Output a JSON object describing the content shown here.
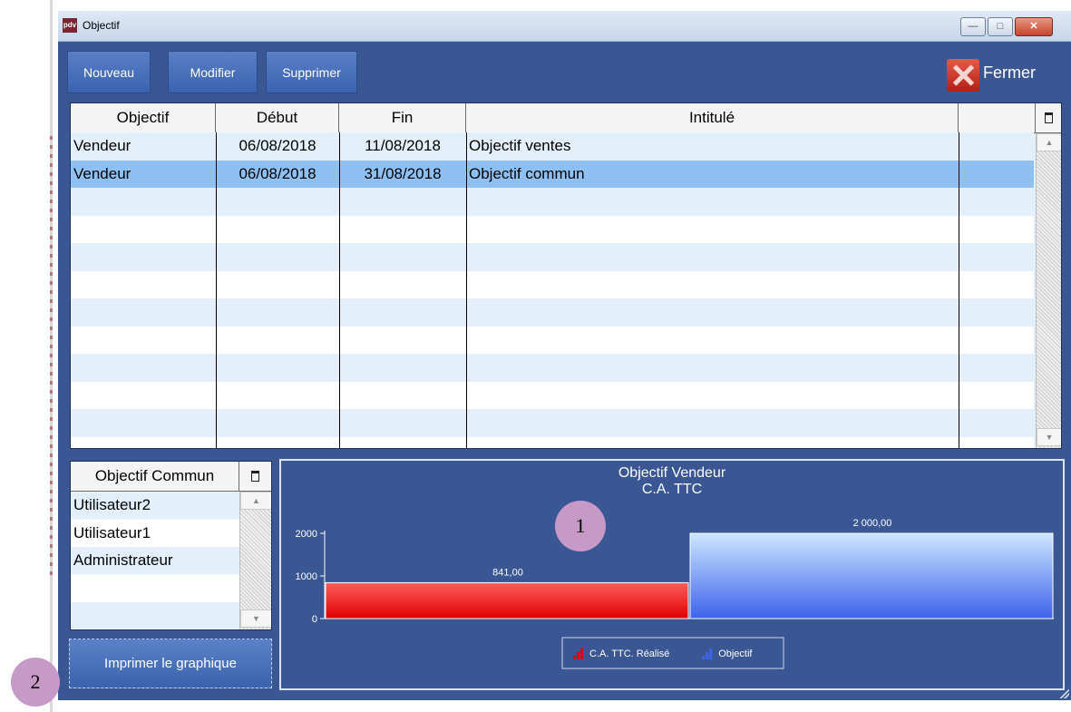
{
  "window": {
    "title": "Objectif",
    "app_icon_text": "pdv",
    "controls": {
      "minimize": "—",
      "maximize": "□",
      "close": "✕"
    }
  },
  "toolbar": {
    "new_label": "Nouveau",
    "modify_label": "Modifier",
    "delete_label": "Supprimer",
    "close_label": "Fermer"
  },
  "objectives_table": {
    "columns": [
      "Objectif",
      "Début",
      "Fin",
      "Intitulé"
    ],
    "rows": [
      {
        "objectif": "Vendeur",
        "debut": "06/08/2018",
        "fin": "11/08/2018",
        "intitule": "Objectif ventes"
      },
      {
        "objectif": "Vendeur",
        "debut": "06/08/2018",
        "fin": "31/08/2018",
        "intitule": "Objectif commun"
      }
    ],
    "selected_row": 1,
    "colors": {
      "row_light": "#e3f0fb",
      "row_white": "#ffffff",
      "row_selected": "#8fc0f2"
    }
  },
  "common_table": {
    "column": "Objectif Commun",
    "rows": [
      "Utilisateur2",
      "Utilisateur1",
      "Administrateur"
    ]
  },
  "print_button": {
    "label": "Imprimer le graphique"
  },
  "callouts": {
    "chart": "1",
    "print": "2"
  },
  "chart_data": {
    "type": "bar",
    "title": "Objectif Vendeur",
    "subtitle": "C.A. TTC",
    "ylim": [
      0,
      2000
    ],
    "yticks": [
      0,
      1000,
      2000
    ],
    "series": [
      {
        "name": "C.A. TTC. Réalisé",
        "value": 841.0,
        "label": "841,00",
        "color_top": "#ff5c5c",
        "color_bottom": "#e00000"
      },
      {
        "name": "Objectif",
        "value": 2000.0,
        "label": "2 000,00",
        "color_top": "#cde6ff",
        "color_bottom": "#3e63ec"
      }
    ],
    "legend_position": "bottom-center",
    "grid": false
  }
}
